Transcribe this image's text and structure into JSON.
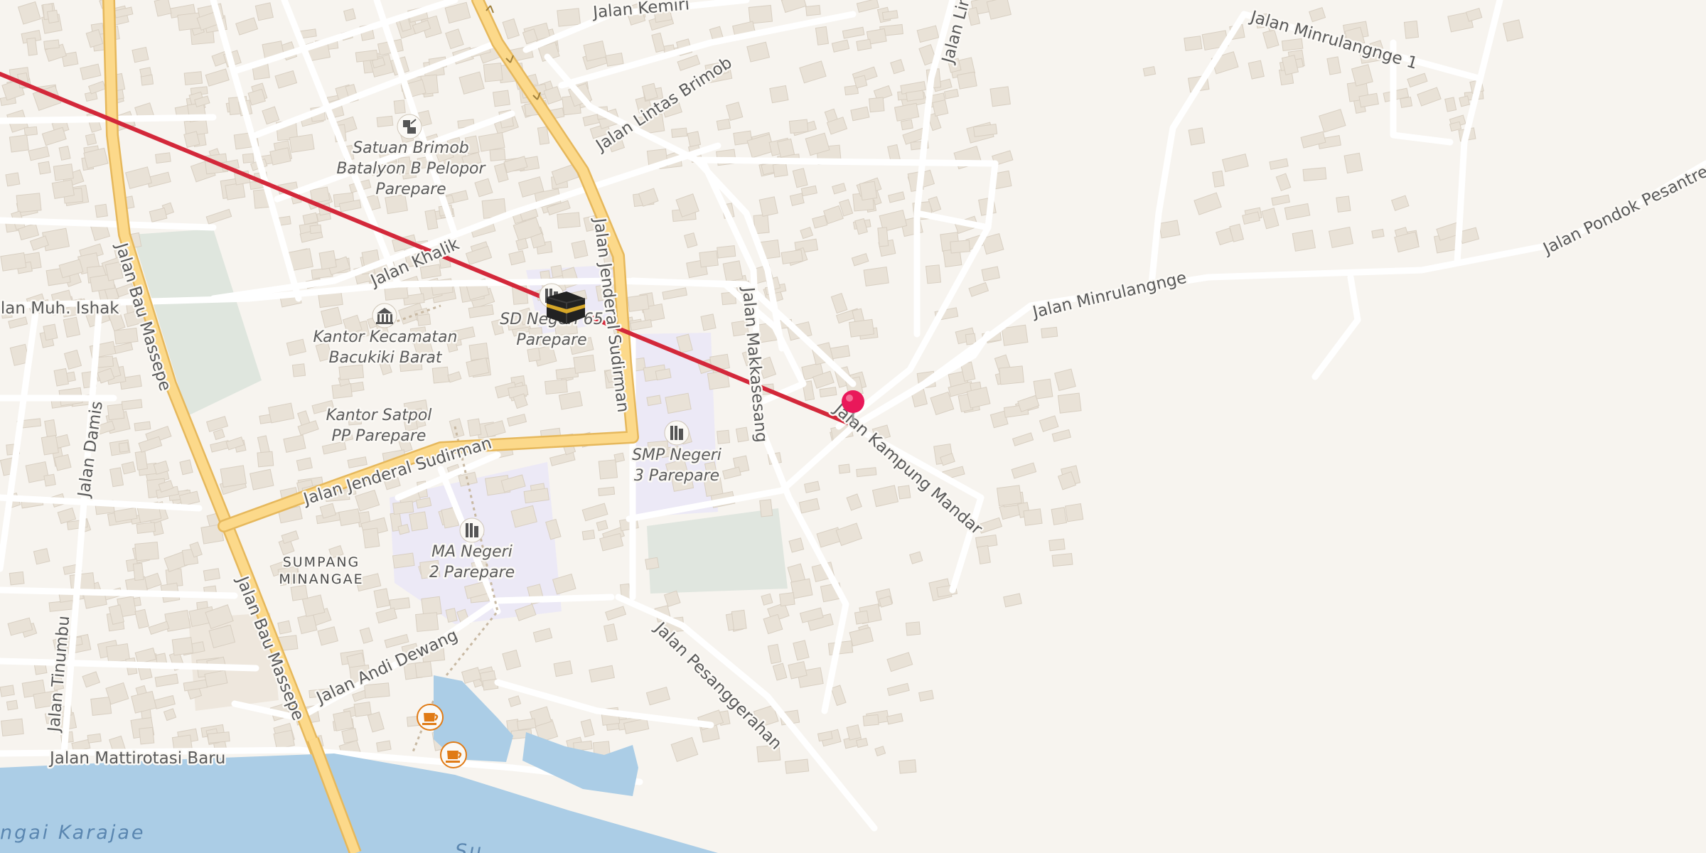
{
  "map": {
    "colors": {
      "background": "#f7f4ef",
      "building": "#e9e2d7",
      "minor_road": "#ffffff",
      "major_road": "#fcd98a",
      "major_road_casing": "#e6b85c",
      "water": "#abcde6",
      "park": "#dfe6de",
      "school_area": "#ece9f6",
      "route": "#d3283a",
      "marker": "#e9185a",
      "cafe_icon": "#e07b16"
    },
    "streets": {
      "bau_massepe_north": "Jalan Bau Massepe",
      "bau_massepe_south": "Jalan Bau Massepe",
      "jenderal_sudirman_west": "Jalan Jenderal Sudirman",
      "jenderal_sudirman_north": "Jalan Jenderal Sudirman",
      "kemiri": "Jalan Kemiri",
      "lintas_brimob": "Jalan Lintas Brimob",
      "khalik": "Jalan Khalik",
      "muh_ishak": "Jalan Muh. Ishak",
      "damis": "Jalan Damis",
      "tinumbu": "Jalan Tinumbu",
      "mattirotasi_baru": "Jalan Mattirotasi Baru",
      "andi_dewang": "Jalan Andi Dewang",
      "pesanggerahan": "Jalan Pesanggerahan",
      "makkasesang": "Jalan Makkasesang",
      "kampung_mandar": "Jalan Kampung Mandar",
      "minrulangnge": "Jalan Minrulangnge",
      "minrulangnge_1": "Jalan Minrulangnge 1",
      "pondok_pesantren": "Jalan Pondok Pesantren Al",
      "lin": "Jalan Lin"
    },
    "places": {
      "brimob_line1": "Satuan Brimob",
      "brimob_line2": "Batalyon B Pelopor",
      "brimob_line3": "Parepare",
      "kecamatan_line1": "Kantor Kecamatan",
      "kecamatan_line2": "Bacukiki Barat",
      "satpol_line1": "Kantor Satpol",
      "satpol_line2": "PP Parepare",
      "sd_line1": "SD Negeri 65",
      "sd_line2": "Parepare",
      "smp_line1": "SMP Negeri",
      "smp_line2": "3 Parepare",
      "ma_line1": "MA Negeri",
      "ma_line2": "2 Parepare"
    },
    "districts": {
      "sumpang_line1": "SUMPANG",
      "sumpang_line2": "MINANGAE"
    },
    "water": {
      "river": "ngai Karajae",
      "river_partial": "Su"
    },
    "icons": {
      "brimob": "police-icon",
      "kecamatan": "townhall-icon",
      "sd": "school-icon",
      "smp": "school-icon",
      "ma": "school-icon",
      "cafe": "cafe-icon",
      "kaaba": "kaaba-icon",
      "marker": "location-pin-icon"
    }
  }
}
